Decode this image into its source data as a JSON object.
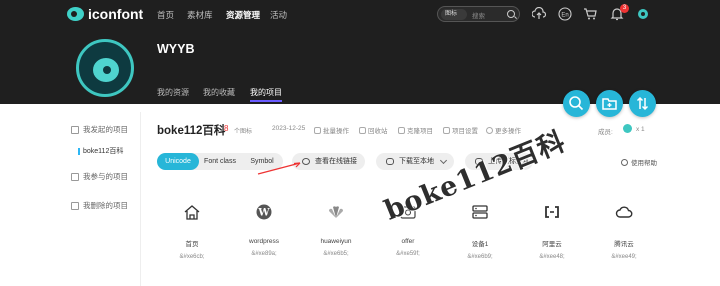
{
  "brand": {
    "name": "iconfont"
  },
  "topnav": {
    "items": [
      {
        "label": "首页"
      },
      {
        "label": "素材库"
      },
      {
        "label": "资源管理"
      },
      {
        "label": "活动"
      }
    ],
    "active_index": 2,
    "search": {
      "type": "图标",
      "placeholder": "搜索"
    },
    "notification_count": "3"
  },
  "profile": {
    "name": "WYYB",
    "tabs": [
      {
        "label": "我的资源"
      },
      {
        "label": "我的收藏"
      },
      {
        "label": "我的项目"
      }
    ],
    "active_tab_index": 2
  },
  "sidebar": {
    "sections": [
      {
        "label": "我发起的项目",
        "children": [
          {
            "label": "boke112百科"
          }
        ]
      },
      {
        "label": "我参与的项目"
      },
      {
        "label": "我删除的项目"
      }
    ]
  },
  "project": {
    "title": "boke112百科",
    "icon_count": "8",
    "icon_count_unit": "个图标",
    "date": "2023-12-25",
    "ops": [
      {
        "label": "批量操作",
        "icon": "batch-icon"
      },
      {
        "label": "回收站",
        "icon": "trash-icon"
      },
      {
        "label": "克隆项目",
        "icon": "clone-icon"
      },
      {
        "label": "项目设置",
        "icon": "settings-icon"
      },
      {
        "label": "更多操作",
        "icon": "more-icon"
      }
    ],
    "members_label": "成员:",
    "members_count": "x 1"
  },
  "toolbar": {
    "tabs": [
      {
        "label": "Unicode"
      },
      {
        "label": "Font class"
      },
      {
        "label": "Symbol"
      }
    ],
    "active_tab_index": 0,
    "view_online_label": "查看在线链接",
    "download_label": "下载至本地",
    "upload_label": "上传图标至项目",
    "help_label": "使用帮助"
  },
  "icons": [
    {
      "name": "首页",
      "code": "&#xe6cb;",
      "icon": "home-icon"
    },
    {
      "name": "wordpress",
      "code": "&#xe89a;",
      "icon": "wordpress-icon"
    },
    {
      "name": "huaweiyun",
      "code": "&#xe6b5;",
      "icon": "huawei-icon"
    },
    {
      "name": "offer",
      "code": "&#xe59f;",
      "icon": "offer-icon"
    },
    {
      "name": "设备1",
      "code": "&#xe6b9;",
      "icon": "server-icon"
    },
    {
      "name": "阿里云",
      "code": "&#xee48;",
      "icon": "aliyun-icon"
    },
    {
      "name": "腾讯云",
      "code": "&#xee49;",
      "icon": "tencent-cloud-icon"
    }
  ],
  "watermark": "boke112百科",
  "colors": {
    "accent": "#27b6d8",
    "nav_bg": "#1f1f1f",
    "tab_underline": "#6a5cff",
    "badge": "#ee3333",
    "count": "#ee3333"
  }
}
